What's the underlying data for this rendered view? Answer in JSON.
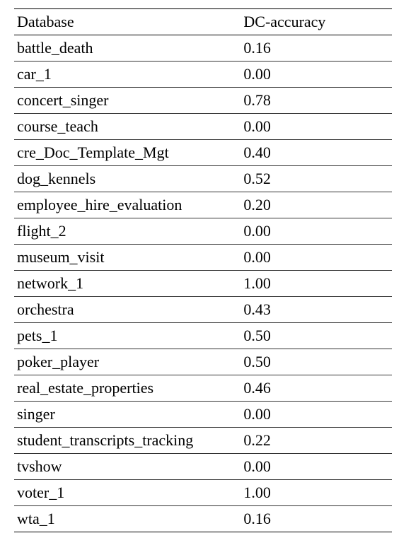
{
  "chart_data": {
    "type": "table",
    "columns": [
      "Database",
      "DC-accuracy"
    ],
    "rows": [
      {
        "database": "battle_death",
        "dc_accuracy": "0.16"
      },
      {
        "database": "car_1",
        "dc_accuracy": "0.00"
      },
      {
        "database": "concert_singer",
        "dc_accuracy": "0.78"
      },
      {
        "database": "course_teach",
        "dc_accuracy": "0.00"
      },
      {
        "database": "cre_Doc_Template_Mgt",
        "dc_accuracy": "0.40"
      },
      {
        "database": "dog_kennels",
        "dc_accuracy": "0.52"
      },
      {
        "database": "employee_hire_evaluation",
        "dc_accuracy": "0.20"
      },
      {
        "database": "flight_2",
        "dc_accuracy": "0.00"
      },
      {
        "database": "museum_visit",
        "dc_accuracy": "0.00"
      },
      {
        "database": "network_1",
        "dc_accuracy": "1.00"
      },
      {
        "database": "orchestra",
        "dc_accuracy": "0.43"
      },
      {
        "database": "pets_1",
        "dc_accuracy": "0.50"
      },
      {
        "database": "poker_player",
        "dc_accuracy": "0.50"
      },
      {
        "database": "real_estate_properties",
        "dc_accuracy": "0.46"
      },
      {
        "database": "singer",
        "dc_accuracy": "0.00"
      },
      {
        "database": "student_transcripts_tracking",
        "dc_accuracy": "0.22"
      },
      {
        "database": "tvshow",
        "dc_accuracy": "0.00"
      },
      {
        "database": "voter_1",
        "dc_accuracy": "1.00"
      },
      {
        "database": "wta_1",
        "dc_accuracy": "0.16"
      }
    ]
  }
}
